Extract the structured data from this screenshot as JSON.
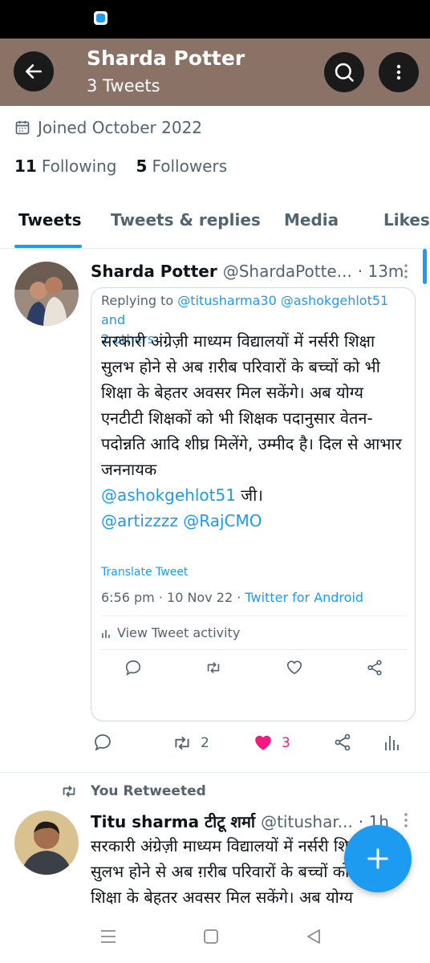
{
  "header": {
    "title": "Sharda Potter",
    "subtitle": "3 Tweets"
  },
  "profile": {
    "joined": "Joined October 2022",
    "following_count": "11",
    "following_label": "Following",
    "followers_count": "5",
    "followers_label": "Followers"
  },
  "tabs": [
    "Tweets",
    "Tweets & replies",
    "Media",
    "Likes"
  ],
  "tweet1": {
    "name": "Sharda Potter",
    "handle": "@ShardaPotte...",
    "time": "· 13m",
    "reply_prefix": "Replying to ",
    "reply_user1": "@titusharma30",
    "reply_user2": "@ashokgehlot51",
    "reply_and": " and",
    "reply_others": "2 others",
    "text": "सरकारी अंग्रेज़ी माध्यम विद्यालयों में नर्सरी शिक्षा सुलभ होने से अब ग़रीब परिवारों के बच्चों को भी शिक्षा के बेहतर अवसर मिल सकेंगे। अब योग्य एनटीटी शिक्षकों को भी शिक्षक पदानुसार वेतन-पदोन्नति आदि शीघ्र मिलेंगे, उम्मीद है। दिल से आभार जननायक",
    "mention1": "@ashokgehlot51",
    "mention1_suffix": " जी।",
    "mention2": "@artizzzz",
    "mention3": "@RajCMO",
    "translate": "Translate Tweet",
    "datetime": "6:56 pm · 10 Nov 22 · ",
    "source": "Twitter for Android",
    "activity": "View Tweet activity",
    "retweets": "2",
    "likes": "3"
  },
  "tweet2": {
    "retweet_label": "You Retweeted",
    "name": "Titu sharma टीटू शर्मा",
    "handle": "@titushar...",
    "time": "· 1h",
    "text": "सरकारी अंग्रेज़ी माध्यम विद्यालयों में नर्सरी शिक्षा सुलभ होने से अब ग़रीब परिवारों के बच्चों को भी शिक्षा के बेहतर अवसर मिल सकेंगे। अब योग्य एनटीटी शिक्षकों को भी शिक्षक"
  },
  "colors": {
    "accent": "#1d9bf0",
    "header_bg": "#8a7266",
    "like": "#f91880"
  }
}
